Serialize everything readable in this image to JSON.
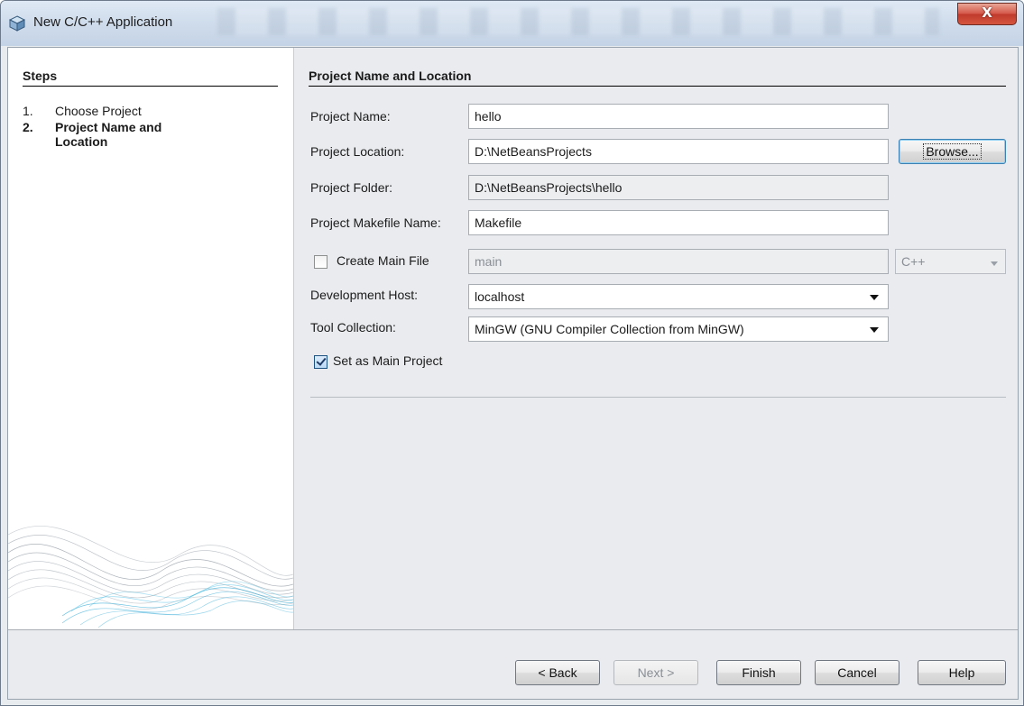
{
  "window": {
    "title": "New C/C++ Application",
    "close_label": "X"
  },
  "steps": {
    "heading": "Steps",
    "items": [
      {
        "num": "1.",
        "label": "Choose Project"
      },
      {
        "num": "2.",
        "label": "Project Name and Location"
      }
    ]
  },
  "form": {
    "heading": "Project Name and Location",
    "project_name_label": "Project Name:",
    "project_name_value": "hello",
    "project_location_label": "Project Location:",
    "project_location_value": "D:\\NetBeansProjects",
    "browse_label": "Browse...",
    "project_folder_label": "Project Folder:",
    "project_folder_value": "D:\\NetBeansProjects\\hello",
    "makefile_label": "Project Makefile Name:",
    "makefile_value": "Makefile",
    "create_main_label": "Create Main File",
    "create_main_checked": false,
    "main_file_value": "main",
    "language_value": "C++",
    "dev_host_label": "Development Host:",
    "dev_host_value": "localhost",
    "tool_collection_label": "Tool Collection:",
    "tool_collection_value": "MinGW (GNU Compiler Collection from MinGW)",
    "set_main_label": "Set as Main Project",
    "set_main_checked": true
  },
  "buttons": {
    "back": "< Back",
    "next": "Next >",
    "finish": "Finish",
    "cancel": "Cancel",
    "help": "Help"
  }
}
